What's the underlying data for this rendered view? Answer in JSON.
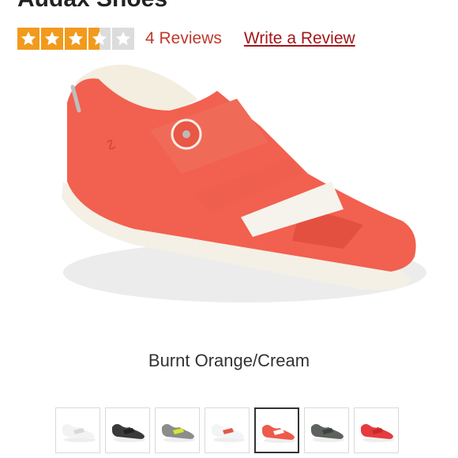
{
  "product": {
    "title": "Audax Shoes"
  },
  "rating": {
    "value": 3.5,
    "max": 5,
    "star_color": "#f29a1c",
    "reviews_text": "4 Reviews",
    "write_review_text": "Write a Review"
  },
  "hero": {
    "icon": "shoe-image"
  },
  "variant": {
    "selected_label": "Burnt Orange/Cream"
  },
  "thumbnails": [
    {
      "color": "#f3f3f3",
      "accent": "#d8d8d8"
    },
    {
      "color": "#3a3a3a",
      "accent": "#222222"
    },
    {
      "color": "#8a8d8a",
      "accent": "#d7e82a"
    },
    {
      "color": "#f2f5f7",
      "accent": "#e05a4a"
    },
    {
      "color": "#ee5a4a",
      "accent": "#ffffff",
      "selected": true
    },
    {
      "color": "#5d625d",
      "accent": "#3f433f"
    },
    {
      "color": "#e53b3f",
      "accent": "#c8282c"
    }
  ]
}
